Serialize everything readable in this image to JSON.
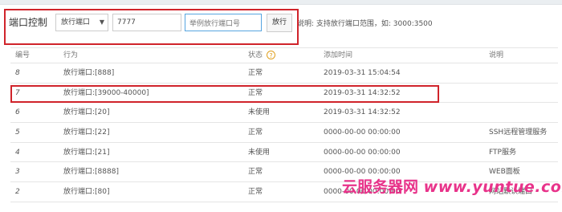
{
  "toolbar": {
    "label": "端口控制",
    "select_value": "放行端口",
    "port_value": "7777",
    "remark_value": "举例放行端口号",
    "remark_placeholder": "举例放行端口号",
    "release_button": "放行",
    "hint": "说明: 支持放行端口范围，如: 3000:3500"
  },
  "table": {
    "headers": {
      "id": "编号",
      "action": "行为",
      "status": "状态",
      "time": "添加时间",
      "remark": "说明"
    },
    "rows": [
      {
        "id": "8",
        "action": "放行端口:[888]",
        "status": "正常",
        "time": "2019-03-31 15:04:54",
        "remark": ""
      },
      {
        "id": "7",
        "action": "放行端口:[39000-40000]",
        "status": "正常",
        "time": "2019-03-31 14:32:52",
        "remark": ""
      },
      {
        "id": "6",
        "action": "放行端口:[20]",
        "status": "未使用",
        "time": "2019-03-31 14:32:52",
        "remark": ""
      },
      {
        "id": "5",
        "action": "放行端口:[22]",
        "status": "正常",
        "time": "0000-00-00 00:00:00",
        "remark": "SSH远程管理服务"
      },
      {
        "id": "4",
        "action": "放行端口:[21]",
        "status": "未使用",
        "time": "0000-00-00 00:00:00",
        "remark": "FTP服务"
      },
      {
        "id": "3",
        "action": "放行端口:[8888]",
        "status": "正常",
        "time": "0000-00-00 00:00:00",
        "remark": "WEB面板"
      },
      {
        "id": "2",
        "action": "放行端口:[80]",
        "status": "正常",
        "time": "0000-00-00 00:00:00",
        "remark": "网站默认端口"
      }
    ]
  },
  "watermark": {
    "cn": "云服务器网",
    "url": "www.yuntue.com"
  },
  "colors": {
    "annotation": "#d0242b",
    "watermark": "#e8338a",
    "help_icon": "#e0a020"
  }
}
